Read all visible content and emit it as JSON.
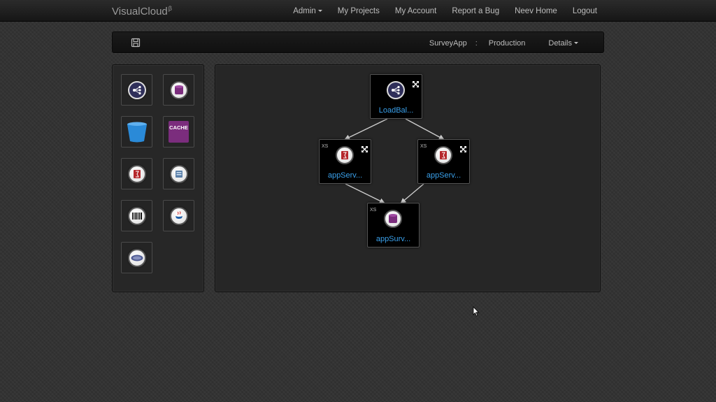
{
  "navbar": {
    "brand": "VisualCloud",
    "brand_superscript": "β",
    "items": [
      {
        "label": "Admin",
        "dropdown": true
      },
      {
        "label": "My Projects"
      },
      {
        "label": "My Account"
      },
      {
        "label": "Report a Bug"
      },
      {
        "label": "Neev Home"
      },
      {
        "label": "Logout"
      }
    ]
  },
  "toolbar": {
    "save_icon": "save-icon",
    "project": "SurveyApp",
    "separator": ":",
    "environment": "Production",
    "details_label": "Details"
  },
  "palette": {
    "items": [
      {
        "icon": "load-balancer-icon"
      },
      {
        "icon": "database-icon"
      },
      {
        "icon": "storage-bucket-icon"
      },
      {
        "icon": "cache-icon",
        "label": "CACHE"
      },
      {
        "icon": "app-server-icon"
      },
      {
        "icon": "server-icon"
      },
      {
        "icon": "barcode-icon"
      },
      {
        "icon": "java-icon",
        "label": "JAVA"
      },
      {
        "icon": "php-icon",
        "label": "php"
      }
    ]
  },
  "canvas": {
    "nodes": [
      {
        "id": "lb",
        "label": "LoadBal...",
        "icon": "load-balancer-icon",
        "size": ""
      },
      {
        "id": "app1",
        "label": "appServ...",
        "icon": "app-server-icon",
        "size": "XS"
      },
      {
        "id": "app2",
        "label": "appServ...",
        "icon": "app-server-icon",
        "size": "XS"
      },
      {
        "id": "db",
        "label": "appSurv...",
        "icon": "database-icon",
        "size": "XS"
      }
    ]
  },
  "colors": {
    "node_label": "#3aa0ea",
    "cache_purple": "#7b2d7d",
    "bucket_blue": "#2a8ad8",
    "database_purple": "#7b2d7d"
  }
}
